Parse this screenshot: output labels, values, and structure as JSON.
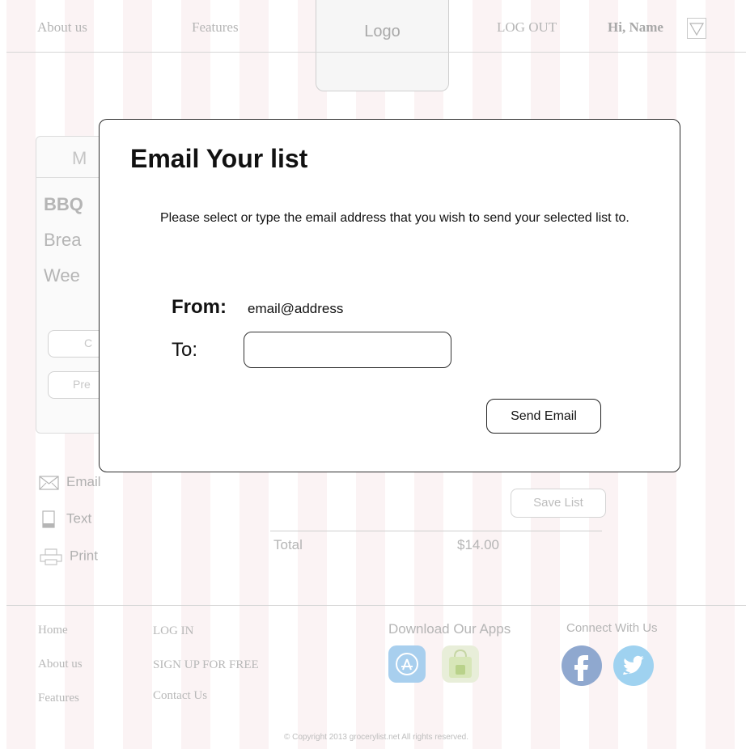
{
  "header": {
    "nav": [
      "About us",
      "Features"
    ],
    "logo": "Logo",
    "logout": "LOG OUT",
    "greeting": "Hi, Name"
  },
  "background": {
    "tab_initial": "M",
    "lines": [
      "BBQ",
      "Brea",
      "Wee"
    ],
    "buttons": [
      "C",
      "Pre"
    ],
    "share": {
      "email": "Email",
      "text": "Text",
      "print": "Print"
    },
    "save_list": "Save List",
    "total_label": "Total",
    "total_value": "$14.00"
  },
  "modal": {
    "title": "Email Your list",
    "description": "Please select or type the email address that you wish to send your selected list to.",
    "from_label": "From:",
    "from_value": "email@address",
    "to_label": "To:",
    "to_value": "",
    "send_button": "Send Email"
  },
  "footer": {
    "col1": [
      "Home",
      "About us",
      "Features"
    ],
    "col2": [
      "LOG IN",
      "SIGN UP FOR FREE",
      "Contact Us"
    ],
    "apps_heading": "Download Our Apps",
    "connect_heading": "Connect With Us",
    "copyright": "© Copyright 2013 grocerylist.net All rights reserved."
  },
  "colors": {
    "stripe": "#fbf3f4",
    "appstore": "#7fb6e2",
    "android": "#9cc36b",
    "facebook": "#4a6fa8",
    "twitter": "#5bb6e8"
  }
}
